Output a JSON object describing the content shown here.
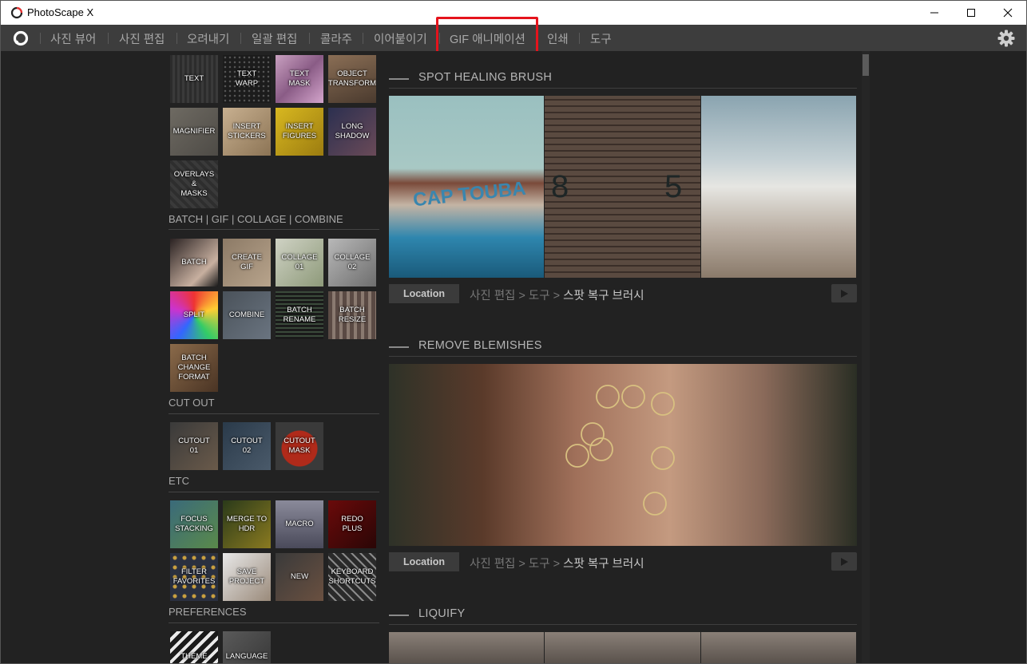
{
  "window": {
    "title": "PhotoScape X"
  },
  "menu": {
    "items": [
      "사진 뷰어",
      "사진 편집",
      "오려내기",
      "일괄 편집",
      "콜라주",
      "이어붙이기",
      "GIF 애니메이션",
      "인쇄",
      "도구"
    ]
  },
  "sidebar": {
    "tools_group": [
      {
        "label": "TEXT"
      },
      {
        "label": "TEXT\nWARP"
      },
      {
        "label": "TEXT\nMASK"
      },
      {
        "label": "OBJECT\nTRANSFORM"
      },
      {
        "label": "MAGNIFIER"
      },
      {
        "label": "INSERT\nSTICKERS"
      },
      {
        "label": "INSERT\nFIGURES"
      },
      {
        "label": "LONG\nSHADOW"
      },
      {
        "label": "OVERLAYS\n&\nMASKS"
      }
    ],
    "batch_title": "BATCH | GIF | COLLAGE | COMBINE",
    "batch_group": [
      {
        "label": "BATCH"
      },
      {
        "label": "CREATE\nGIF"
      },
      {
        "label": "COLLAGE\n01"
      },
      {
        "label": "COLLAGE\n02"
      },
      {
        "label": "SPLIT"
      },
      {
        "label": "COMBINE"
      },
      {
        "label": "BATCH\nRENAME"
      },
      {
        "label": "BATCH\nRESIZE"
      },
      {
        "label": "BATCH\nCHANGE\nFORMAT"
      }
    ],
    "cutout_title": "CUT OUT",
    "cutout_group": [
      {
        "label": "CUTOUT\n01"
      },
      {
        "label": "CUTOUT\n02"
      },
      {
        "label": "CUTOUT\nMASK"
      }
    ],
    "etc_title": "ETC",
    "etc_group": [
      {
        "label": "FOCUS\nSTACKING"
      },
      {
        "label": "MERGE TO\nHDR"
      },
      {
        "label": "MACRO"
      },
      {
        "label": "REDO\nPLUS"
      },
      {
        "label": "FILTER\nFAVORITES"
      },
      {
        "label": "SAVE\nPROJECT"
      },
      {
        "label": "NEW"
      },
      {
        "label": "KEYBOARD\nSHORTCUTS"
      }
    ],
    "prefs_title": "PREFERENCES",
    "prefs_group": [
      {
        "label": "THEME"
      },
      {
        "label": "LANGUAGE"
      }
    ]
  },
  "sections": [
    {
      "title": "SPOT HEALING BRUSH",
      "location_label": "Location",
      "path": [
        "사진 편집",
        "도구",
        "스팟 복구 브러시"
      ],
      "photo_text": [
        "CAP TOUBA",
        "8",
        "5"
      ]
    },
    {
      "title": "REMOVE BLEMISHES",
      "location_label": "Location",
      "path": [
        "사진 편집",
        "도구",
        "스팟 복구 브러시"
      ]
    },
    {
      "title": "LIQUIFY"
    }
  ],
  "colors": {
    "highlight": "#e5131c",
    "menu_bg": "#3d3d3d",
    "panel_bg": "#222222"
  }
}
